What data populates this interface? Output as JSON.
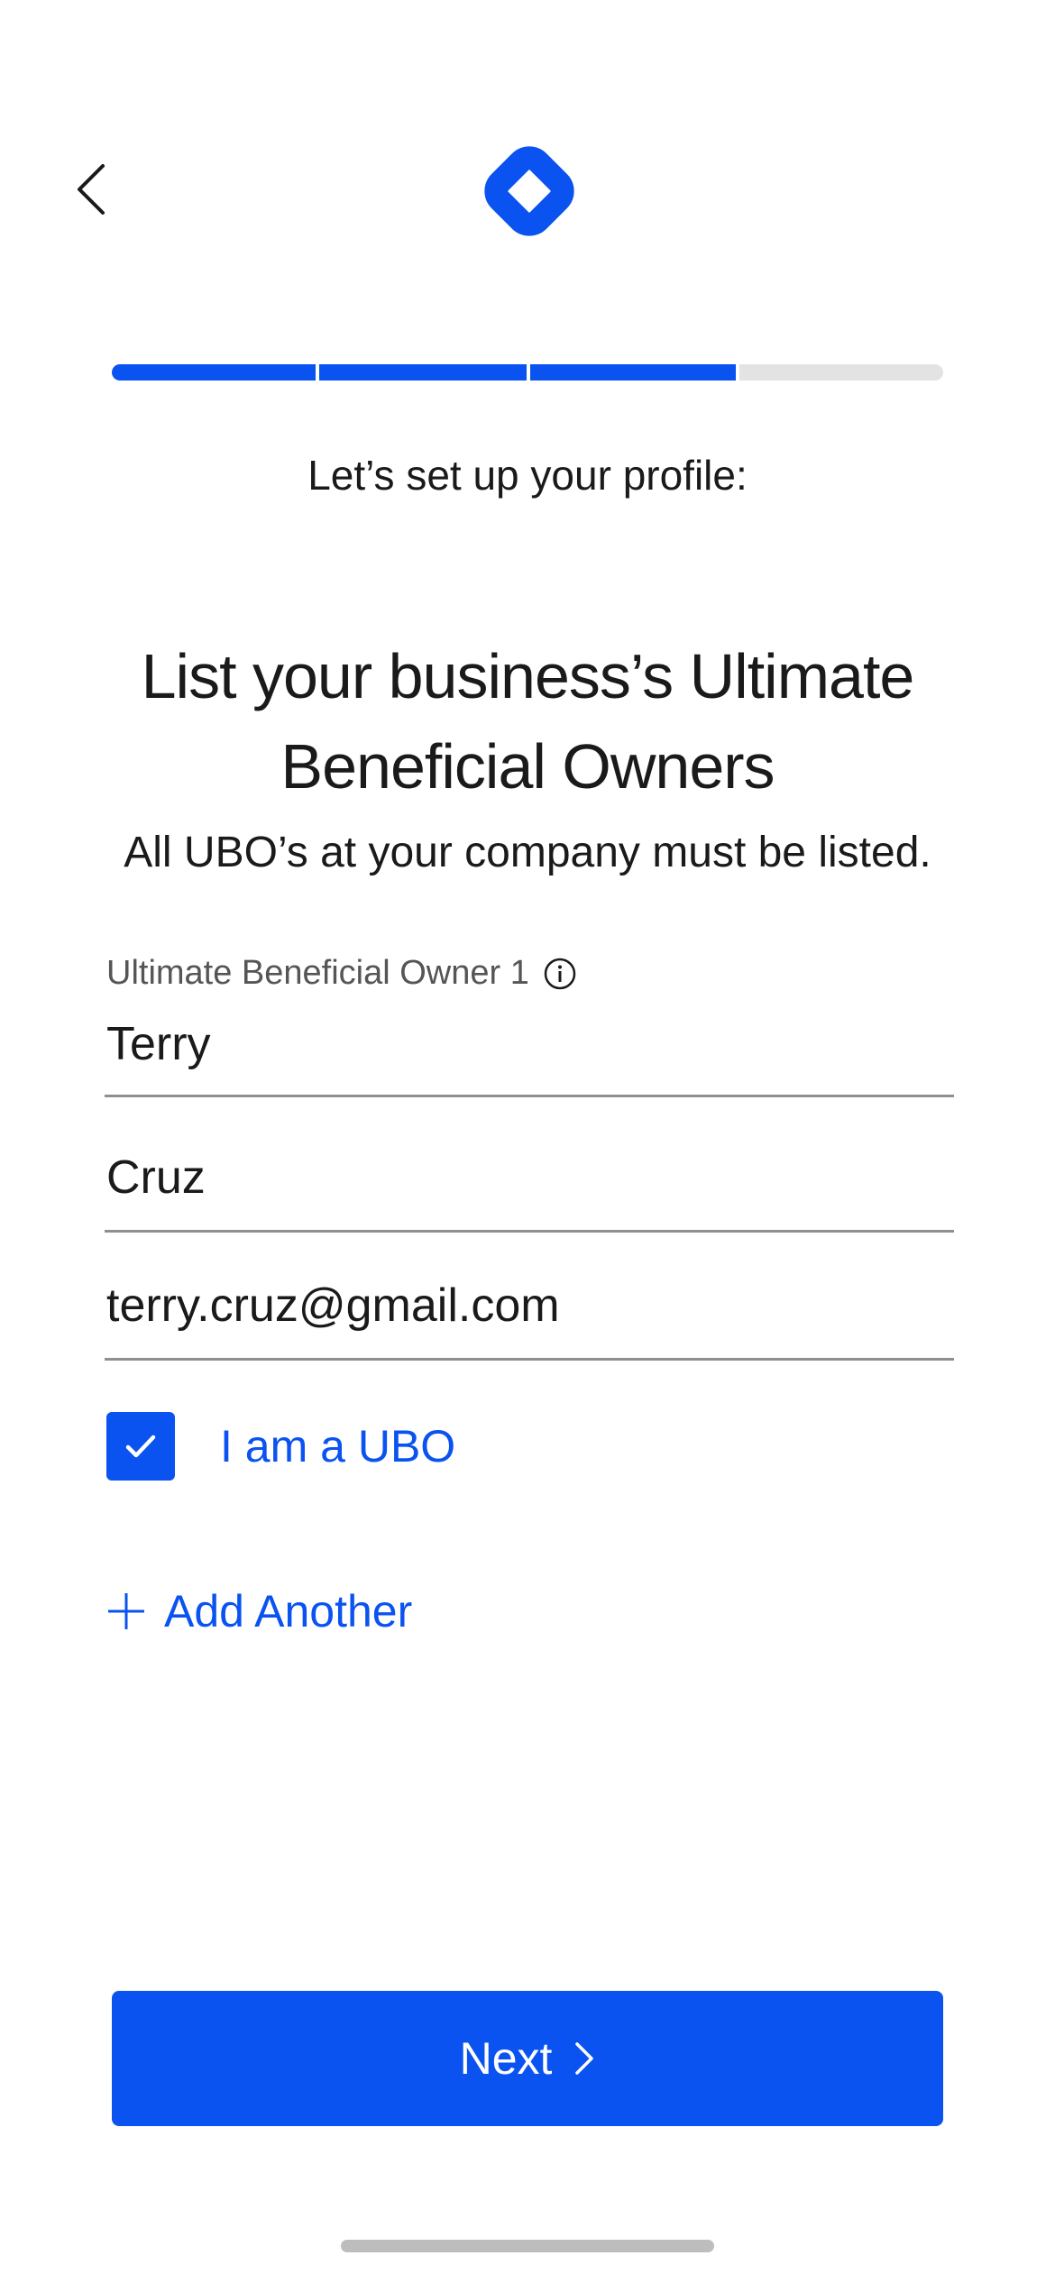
{
  "header": {
    "back_icon": "chevron-left-icon",
    "logo_icon": "diamond-logo-icon"
  },
  "progress": {
    "total_steps": 4,
    "completed_steps": 3
  },
  "step_label": "Let’s set up your profile:",
  "heading": "List your business’s Ultimate Beneficial Owners",
  "subheading": "All UBO’s at your company must be listed.",
  "owner": {
    "label": "Ultimate Beneficial Owner 1",
    "info_icon": "info-icon",
    "first_name": "Terry",
    "last_name": "Cruz",
    "email": "terry.cruz@gmail.com"
  },
  "ubo_checkbox": {
    "label": "I am a UBO",
    "checked": true
  },
  "add_another": {
    "label": "Add Another",
    "icon": "plus-icon"
  },
  "next_button": {
    "label": "Next",
    "icon": "chevron-right-icon"
  },
  "colors": {
    "accent": "#0a53f0",
    "progress_track": "#e3e3e3",
    "text": "#1a1a1a",
    "muted": "#555555"
  }
}
